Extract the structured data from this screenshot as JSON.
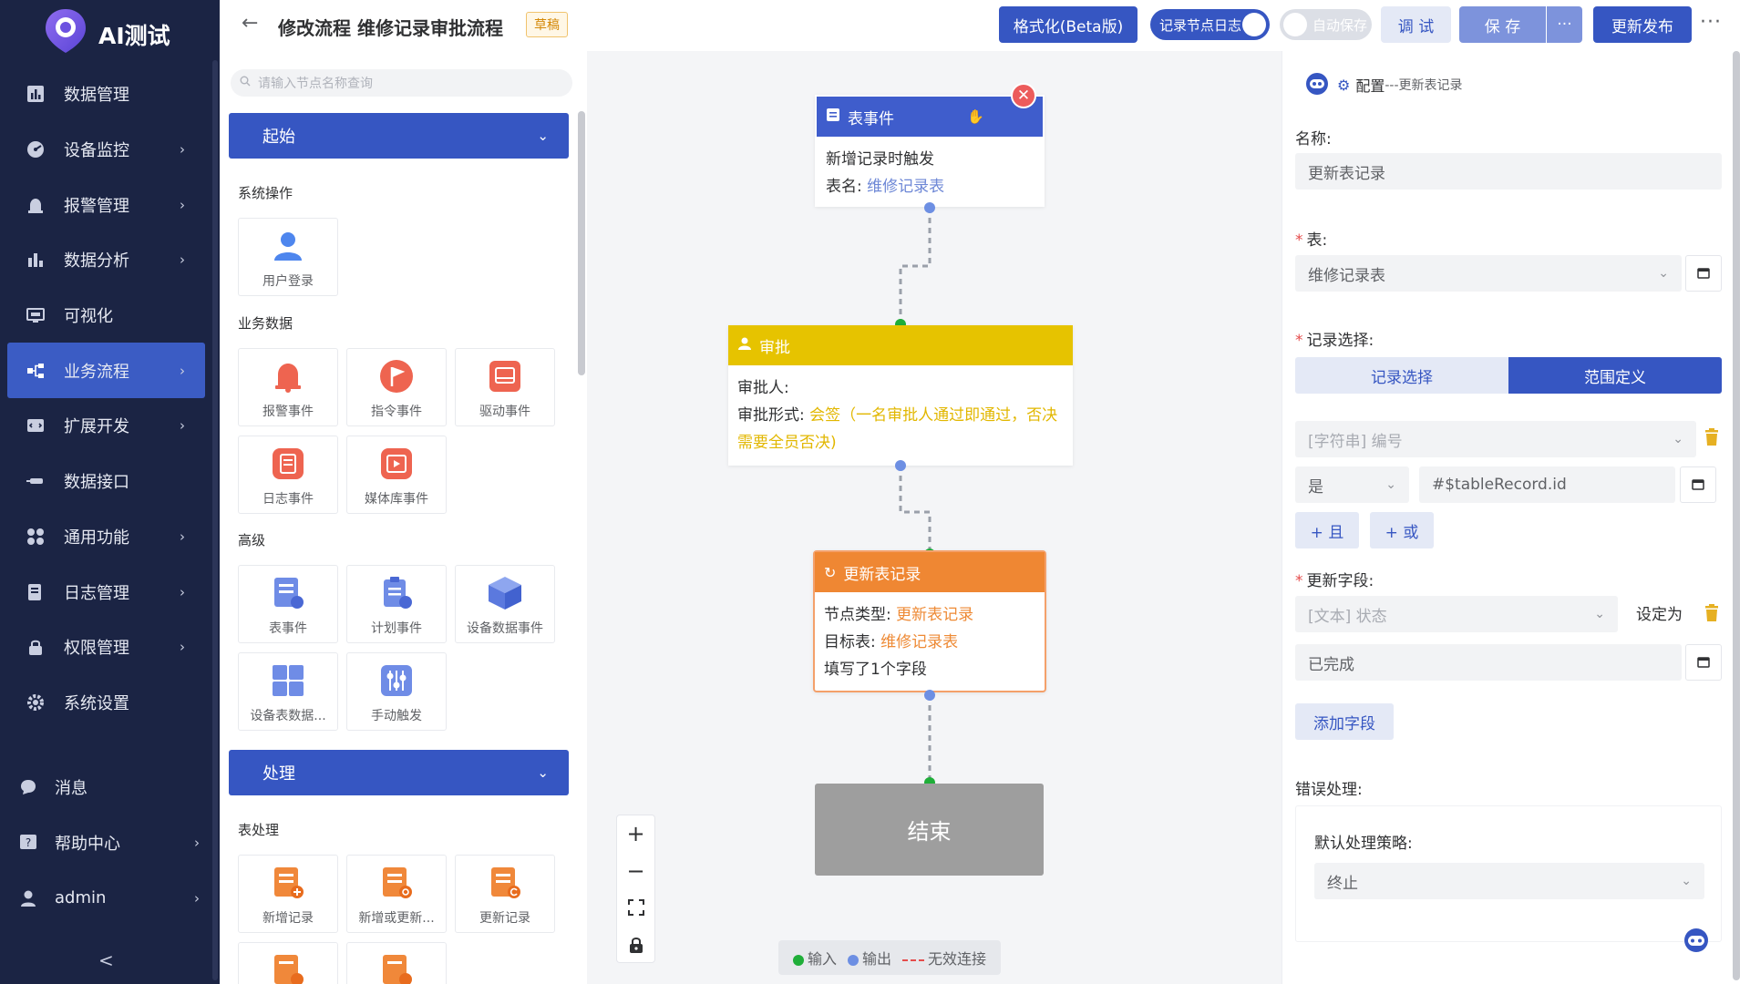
{
  "app": {
    "title": "AI测试"
  },
  "sidebar": {
    "items": [
      {
        "label": "数据管理",
        "icon": "bar-chart-icon",
        "chevron": false
      },
      {
        "label": "设备监控",
        "icon": "monitor-icon",
        "chevron": true
      },
      {
        "label": "报警管理",
        "icon": "alarm-icon",
        "chevron": true
      },
      {
        "label": "数据分析",
        "icon": "analysis-icon",
        "chevron": true
      },
      {
        "label": "可视化",
        "icon": "visual-icon",
        "chevron": false
      },
      {
        "label": "业务流程",
        "icon": "flow-icon",
        "chevron": true,
        "active": true
      },
      {
        "label": "扩展开发",
        "icon": "extension-icon",
        "chevron": true
      },
      {
        "label": "数据接口",
        "icon": "api-icon",
        "chevron": false
      },
      {
        "label": "通用功能",
        "icon": "grid-icon",
        "chevron": true
      },
      {
        "label": "日志管理",
        "icon": "log-icon",
        "chevron": true
      },
      {
        "label": "权限管理",
        "icon": "lock-icon",
        "chevron": true
      },
      {
        "label": "系统设置",
        "icon": "gear-icon",
        "chevron": false
      }
    ],
    "bottom": [
      {
        "label": "消息",
        "icon": "message-icon"
      },
      {
        "label": "帮助中心",
        "icon": "help-icon"
      },
      {
        "label": "admin",
        "icon": "user-icon"
      }
    ],
    "collapse_glyph": "<"
  },
  "header": {
    "title": "修改流程 维修记录审批流程",
    "badge": "草稿",
    "format_btn": "格式化(Beta版)",
    "log_toggle": "记录节点日志",
    "auto_save": "自动保存",
    "debug_btn": "调 试",
    "save_btn": "保 存",
    "more_btn": "···",
    "publish_btn": "更新发布",
    "menu": "···"
  },
  "palette": {
    "search_placeholder": "请输入节点名称查询",
    "group_start": "起始",
    "group_process": "处理",
    "cat_system": "系统操作",
    "cat_business": "业务数据",
    "cat_advanced": "高级",
    "cat_table": "表处理",
    "tiles": {
      "user_login": "用户登录",
      "alarm_event": "报警事件",
      "command_event": "指令事件",
      "drive_event": "驱动事件",
      "log_event": "日志事件",
      "media_event": "媒体库事件",
      "table_event": "表事件",
      "schedule_event": "计划事件",
      "device_data_event": "设备数据事件",
      "device_table_data": "设备表数据...",
      "manual_trigger": "手动触发",
      "add_record": "新增记录",
      "add_or_update": "新增或更新...",
      "update_record": "更新记录"
    }
  },
  "canvas": {
    "node_table_event": {
      "title": "表事件",
      "line1": "新增记录时触发",
      "line2_label": "表名: ",
      "line2_value": "维修记录表"
    },
    "node_approval": {
      "title": "审批",
      "line1": "审批人:",
      "line2_label": "审批形式: ",
      "line2_value": "会签（一名审批人通过即通过，否决需要全员否决)"
    },
    "node_update": {
      "title": "更新表记录",
      "line1_label": "节点类型: ",
      "line1_value": "更新表记录",
      "line2_label": "目标表: ",
      "line2_value": "维修记录表",
      "line3": "填写了1个字段"
    },
    "node_end": {
      "title": "结束"
    },
    "zoom": {
      "plus": "+",
      "minus": "−",
      "fit": "⛶",
      "lock": "🔒"
    },
    "legend": {
      "input": "输入",
      "output": "输出",
      "invalid": "无效连接"
    }
  },
  "config": {
    "header_title": "配置",
    "header_sub": "---更新表记录",
    "name_label": "名称:",
    "name_value": "更新表记录",
    "table_label": "表:",
    "table_value": "维修记录表",
    "record_label": "记录选择:",
    "seg_record": "记录选择",
    "seg_range": "范围定义",
    "cond_field": "[字符串] 编号",
    "cond_op": "是",
    "cond_value": "#$tableRecord.id",
    "and_btn": "+ 且",
    "or_btn": "+ 或",
    "update_label": "更新字段:",
    "update_field": "[文本] 状态",
    "set_to": "设定为",
    "update_value": "已完成",
    "add_field_btn": "添加字段",
    "error_label": "错误处理:",
    "strategy_label": "默认处理策略:",
    "strategy_value": "终止"
  },
  "colors": {
    "sidebar_bg": "#1b2444",
    "primary": "#3656c2",
    "approval": "#e8c400",
    "update": "#ef8733",
    "end": "#9e9e9e"
  }
}
